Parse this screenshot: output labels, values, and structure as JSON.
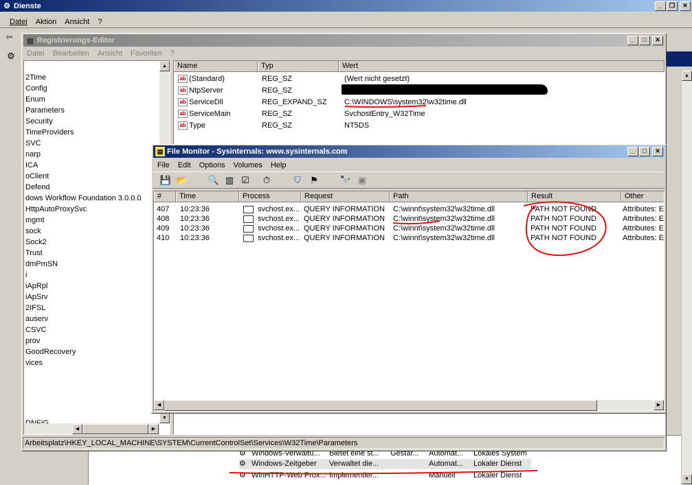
{
  "services_window": {
    "title": "Dienste",
    "menu": [
      "Datei",
      "Aktion",
      "Ansicht",
      "?"
    ],
    "rows": [
      {
        "name": "Windows-Verwaltu...",
        "desc": "Bietet eine st...",
        "status": "Gestar...",
        "start": "Automat...",
        "logon": "Lokales System"
      },
      {
        "name": "Windows-Zeitgeber",
        "desc": "Verwaltet die...",
        "status": "",
        "start": "Automat...",
        "logon": "Lokaler Dienst"
      },
      {
        "name": "WinHTTP-Web Prox...",
        "desc": "Implementier...",
        "status": "",
        "start": "Manuell",
        "logon": "Lokaler Dienst"
      }
    ]
  },
  "regedit": {
    "title": "Registrierungs-Editor",
    "menu": [
      "Datei",
      "Bearbeiten",
      "Ansicht",
      "Favoriten",
      "?"
    ],
    "tree": [
      "2Time",
      "Config",
      "Enum",
      "Parameters",
      "Security",
      "TimeProviders",
      "SVC",
      "narp",
      "ICA",
      "oClient",
      "Defend",
      "dows Workflow Foundation 3.0.0.0",
      "HttpAutoProxySvc",
      "mgmt",
      "sock",
      "Sock2",
      "Trust",
      "dmPmSN",
      "i",
      "iApRpl",
      "iApSrv",
      "2IFSL",
      "auserv",
      "CSVC",
      "prov",
      "GoodRecovery",
      "vices",
      "DNFIG"
    ],
    "columns": [
      "Name",
      "Typ",
      "Wert"
    ],
    "values": [
      {
        "name": "(Standard)",
        "type": "REG_SZ",
        "data": "(Wert nicht gesetzt)"
      },
      {
        "name": "NtpServer",
        "type": "REG_SZ",
        "data": ""
      },
      {
        "name": "ServiceDll",
        "type": "REG_EXPAND_SZ",
        "data": "C:\\WINDOWS\\system32\\w32time.dll"
      },
      {
        "name": "ServiceMain",
        "type": "REG_SZ",
        "data": "SvchostEntry_W32Time"
      },
      {
        "name": "Type",
        "type": "REG_SZ",
        "data": "NT5DS"
      }
    ],
    "status_path": "Arbeitsplatz\\HKEY_LOCAL_MACHINE\\SYSTEM\\CurrentControlSet\\Services\\W32Time\\Parameters"
  },
  "filemon": {
    "title": "File Monitor - Sysinternals: www.sysinternals.com",
    "menu": [
      "File",
      "Edit",
      "Options",
      "Volumes",
      "Help"
    ],
    "columns": [
      "#",
      "Time",
      "Process",
      "Request",
      "Path",
      "Result",
      "Other"
    ],
    "rows": [
      {
        "num": "407",
        "time": "10:23:36",
        "process": "svchost.ex...",
        "request": "QUERY INFORMATION",
        "path": "C:\\winnt\\system32\\w32time.dll",
        "result": "PATH NOT FOUND",
        "other": "Attributes: Er"
      },
      {
        "num": "408",
        "time": "10:23:36",
        "process": "svchost.ex...",
        "request": "QUERY INFORMATION",
        "path": "C:\\winnt\\system32\\w32time.dll",
        "result": "PATH NOT FOUND",
        "other": "Attributes: Er"
      },
      {
        "num": "409",
        "time": "10:23:36",
        "process": "svchost.ex...",
        "request": "QUERY INFORMATION",
        "path": "C:\\winnt\\system32\\w32time.dll",
        "result": "PATH NOT FOUND",
        "other": "Attributes: Er"
      },
      {
        "num": "410",
        "time": "10:23:36",
        "process": "svchost.ex...",
        "request": "QUERY INFORMATION",
        "path": "C:\\winnt\\system32\\w32time.dll",
        "result": "PATH NOT FOUND",
        "other": "Attributes: Er"
      }
    ]
  },
  "colors": {
    "titlebar_active": "#0a246a",
    "annotation": "#e01010"
  }
}
